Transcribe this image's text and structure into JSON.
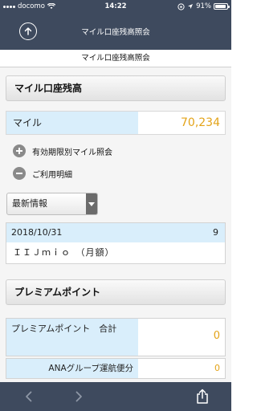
{
  "status_bar": {
    "carrier": "docomo",
    "time": "14:22",
    "battery": "91%",
    "battery_level": 0.91
  },
  "header": {
    "title": "マイル口座残高照会"
  },
  "page_title": "マイル口座残高照会",
  "mile_section": {
    "title": "マイル口座残高",
    "label": "マイル",
    "value": "70,234"
  },
  "links": {
    "expiry": "有効期限別マイル照会",
    "usage": "ご利用明細"
  },
  "filter": {
    "selected": "最新情報"
  },
  "detail": {
    "date": "2018/10/31",
    "number": "9",
    "description": "ＩＩＪｍｉｏ　（月額）"
  },
  "premium_section": {
    "title": "プレミアムポイント",
    "total_label": "プレミアムポイント　合計",
    "total_value": "0",
    "ana_label": "ANAグループ運航便分",
    "ana_value": "0"
  },
  "icons": {
    "back": "back-circle-icon",
    "prev": "chevron-left-icon",
    "next": "chevron-right-icon",
    "share": "share-icon"
  },
  "colors": {
    "header_bg": "#3e4a5e",
    "accent_value": "#e3a318",
    "row_highlight": "#d9eefb"
  }
}
